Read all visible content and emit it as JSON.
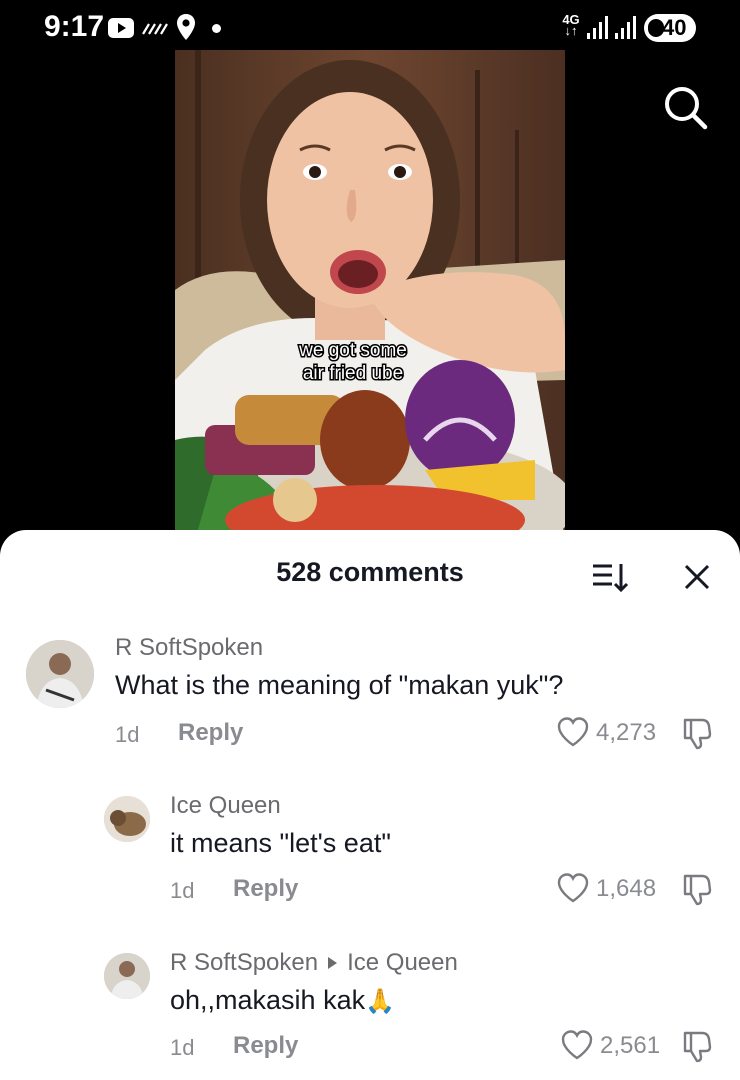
{
  "status_bar": {
    "time": "9:17",
    "network": "4G",
    "battery": "40"
  },
  "video": {
    "caption_line1": "we got some",
    "caption_line2": "air fried ube"
  },
  "comments_panel": {
    "title": "528 comments"
  },
  "comments": [
    {
      "user": "R SoftSpoken",
      "text": "What is the meaning of \"makan yuk\"?",
      "age": "1d",
      "reply_label": "Reply",
      "likes": "4,273"
    },
    {
      "user": "Ice Queen",
      "text": "it means \"let's eat\"",
      "age": "1d",
      "reply_label": "Reply",
      "likes": "1,648"
    },
    {
      "user": "R SoftSpoken",
      "reply_to": "Ice Queen",
      "text": "oh,,makasih kak",
      "emoji": "🙏",
      "age": "1d",
      "reply_label": "Reply",
      "likes": "2,561"
    }
  ]
}
